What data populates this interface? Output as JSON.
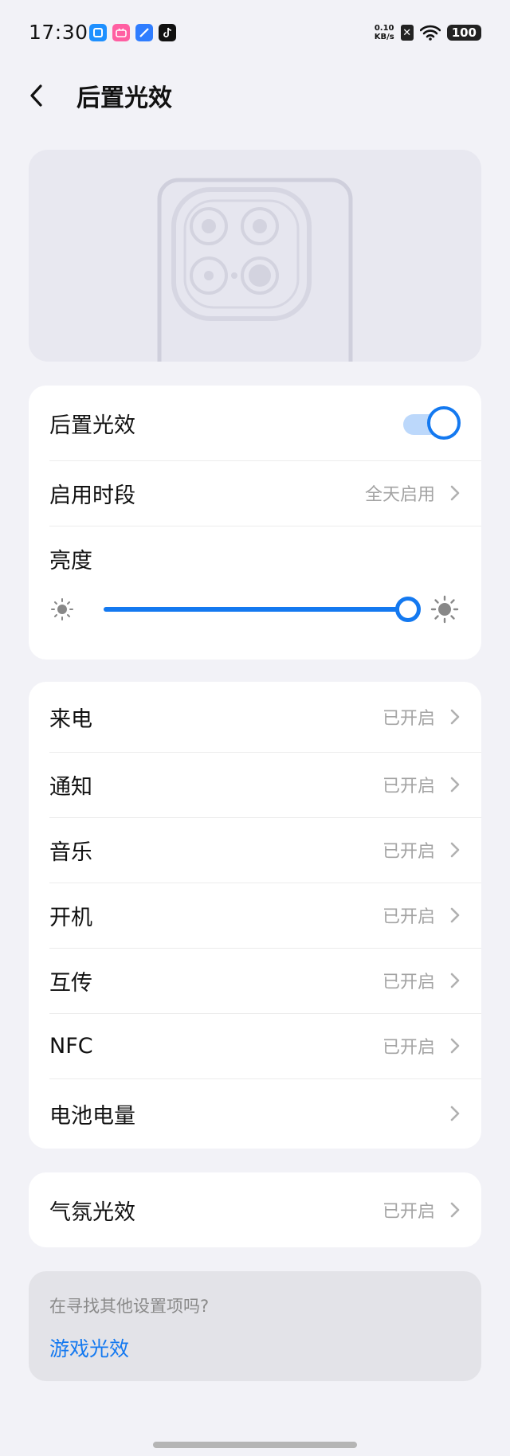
{
  "status_bar": {
    "time": "17:30",
    "net_speed_value": "0.10",
    "net_speed_unit": "KB/s",
    "battery": "100",
    "app_icons": [
      {
        "name": "app-blue-icon",
        "color": "#1e90ff",
        "glyph": "▢"
      },
      {
        "name": "app-bilibili-icon",
        "color": "#ff5fa2",
        "glyph": "b"
      },
      {
        "name": "app-feather-icon",
        "color": "#2f7dff",
        "glyph": "⟋"
      },
      {
        "name": "app-tiktok-icon",
        "color": "#111111",
        "glyph": "♪"
      }
    ]
  },
  "header": {
    "title": "后置光效",
    "back_icon": "chevron-left-icon"
  },
  "main_card": {
    "light_effect_label": "后置光效",
    "light_effect_on": true,
    "schedule_label": "启用时段",
    "schedule_value": "全天启用",
    "brightness_label": "亮度",
    "brightness_level": 1.0
  },
  "scenes": [
    {
      "label": "来电",
      "value": "已开启"
    },
    {
      "label": "通知",
      "value": "已开启"
    },
    {
      "label": "音乐",
      "value": "已开启"
    },
    {
      "label": "开机",
      "value": "已开启"
    },
    {
      "label": "互传",
      "value": "已开启"
    },
    {
      "label": "NFC",
      "value": "已开启"
    },
    {
      "label": "电池电量",
      "value": ""
    }
  ],
  "ambient": {
    "label": "气氛光效",
    "value": "已开启"
  },
  "search_hint": {
    "question": "在寻找其他设置项吗?",
    "link": "游戏光效"
  },
  "colors": {
    "accent": "#1479f0",
    "background": "#f2f2f7"
  }
}
